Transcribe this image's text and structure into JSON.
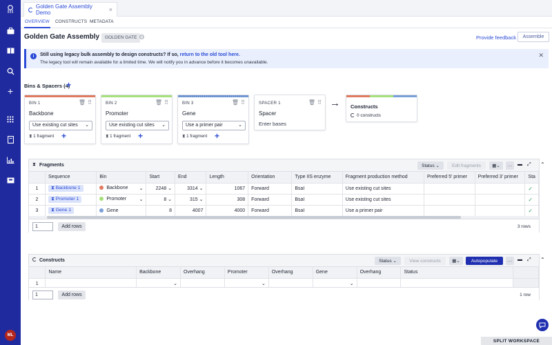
{
  "window": {
    "tab_title": "Golden Gate Assembly Demo",
    "tab_close": "×"
  },
  "subtabs": [
    "OVERVIEW",
    "CONSTRUCTS",
    "METADATA"
  ],
  "header": {
    "title": "Golden Gate Assembly Demo",
    "badge": "GOLDEN GATE",
    "feedback_link": "Provide feedback",
    "assemble_button": "Assemble"
  },
  "banner": {
    "line1_prefix": "Still using legacy bulk assembly to design constructs? If so,",
    "line1_link": "return to the old tool here.",
    "line2": "The legacy tool will remain available for a limited time. We will notify you in advance before it becomes unavailable."
  },
  "bins_section": {
    "heading": "Bins & Spacers (4)"
  },
  "bins": [
    {
      "head": "BIN 1",
      "name": "Backbone",
      "method": "Use existing cut sites",
      "fragments": "1 fragment",
      "color": "#e07a5f"
    },
    {
      "head": "BIN 2",
      "name": "Promoter",
      "method": "Use existing cut sites",
      "fragments": "1 fragment",
      "color": "#a6e07a"
    },
    {
      "head": "BIN 3",
      "name": "Gene",
      "method": "Use a primer pair",
      "fragments": "1 fragment",
      "color": "#7a9fd8"
    }
  ],
  "spacer": {
    "head": "SPACER 1",
    "name": "Spacer",
    "placeholder": "Enter bases"
  },
  "constructs_card": {
    "name": "Constructs",
    "count": "0 constructs"
  },
  "fragments_panel": {
    "title": "Fragments",
    "status_button": "Status",
    "edit_button": "Edit fragments",
    "columns": [
      "Sequence",
      "Bin",
      "Start",
      "End",
      "Length",
      "Orientation",
      "Type IIS enzyme",
      "Fragment production method",
      "Preferred 5' primer",
      "Preferred 3' primer",
      "Sta"
    ],
    "rows": [
      {
        "idx": "1",
        "sequence": "Backbone 1",
        "bin": "Backbone",
        "bin_color": "#e07a5f",
        "start": "2248",
        "end": "3314",
        "length": "1067",
        "orientation": "Forward",
        "enzyme": "BsaI",
        "method": "Use existing cut sites"
      },
      {
        "idx": "2",
        "sequence": "Promoter 1",
        "bin": "Promoter",
        "bin_color": "#a6e07a",
        "start": "8",
        "end": "315",
        "length": "308",
        "orientation": "Forward",
        "enzyme": "BsaI",
        "method": "Use existing cut sites"
      },
      {
        "idx": "3",
        "sequence": "Gene 1",
        "bin": "Gene",
        "bin_color": "#7a9fd8",
        "start": "8",
        "end": "4007",
        "length": "4000",
        "orientation": "Forward",
        "enzyme": "BsaI",
        "method": "Use a primer pair"
      }
    ],
    "page_value": "1",
    "add_rows": "Add rows",
    "row_count": "3 rows"
  },
  "constructs_panel": {
    "title": "Constructs",
    "status_button": "Status",
    "view_button": "View constructs",
    "autopopulate_button": "Autopopulate",
    "columns": [
      "Name",
      "Backbone",
      "Overhang",
      "Promoter",
      "Overhang",
      "Gene",
      "Overhang",
      "Status"
    ],
    "rows": [
      {
        "idx": "1"
      }
    ],
    "page_value": "1",
    "add_rows": "Add rows",
    "row_count": "1 row"
  },
  "footer": {
    "split_workspace": "SPLIT WORKSPACE"
  },
  "user": {
    "initials": "ML"
  }
}
